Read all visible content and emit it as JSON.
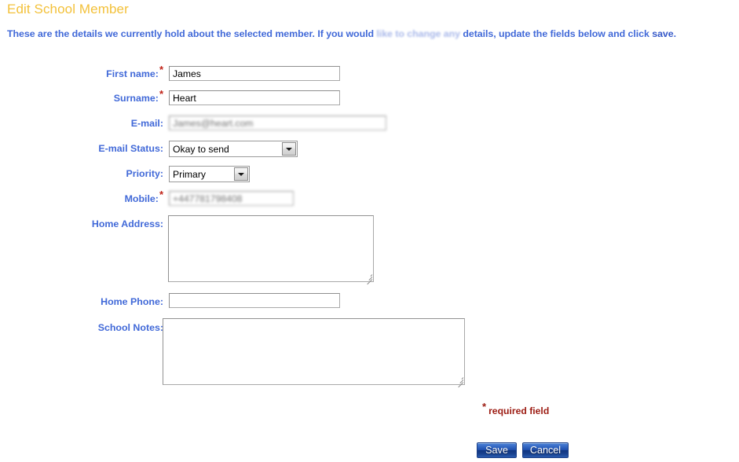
{
  "page": {
    "title": "Edit School Member",
    "intro": {
      "part1": "These are the details we currently hold about the selected member. If you would ",
      "blurred": "like to change any",
      "part2": " details, update the fields below and click ",
      "emphasis": "save",
      "part3": "."
    },
    "title_color": "#f3c13a",
    "label_color": "#4169d8",
    "required_color": "#c02318"
  },
  "fields": {
    "first_name": {
      "label": "First name:",
      "required": true,
      "value": "James"
    },
    "surname": {
      "label": "Surname:",
      "required": true,
      "value": "Heart"
    },
    "email": {
      "label": "E-mail:",
      "required": false,
      "value": "James@heart.com",
      "blurred": true
    },
    "email_status": {
      "label": "E-mail Status:",
      "required": false,
      "value": "Okay to send",
      "options": [
        "Okay to send"
      ]
    },
    "priority": {
      "label": "Priority:",
      "required": false,
      "value": "Primary",
      "options": [
        "Primary"
      ]
    },
    "mobile": {
      "label": "Mobile:",
      "required": true,
      "value": "+447781798408",
      "blurred": true
    },
    "home_address": {
      "label": "Home Address:",
      "required": false,
      "value": ""
    },
    "home_phone": {
      "label": "Home Phone:",
      "required": false,
      "value": ""
    },
    "school_notes": {
      "label": "School Notes:",
      "required": false,
      "value": ""
    }
  },
  "footer": {
    "required_note": "required field",
    "required_star": "*",
    "save_label": "Save",
    "cancel_label": "Cancel"
  }
}
